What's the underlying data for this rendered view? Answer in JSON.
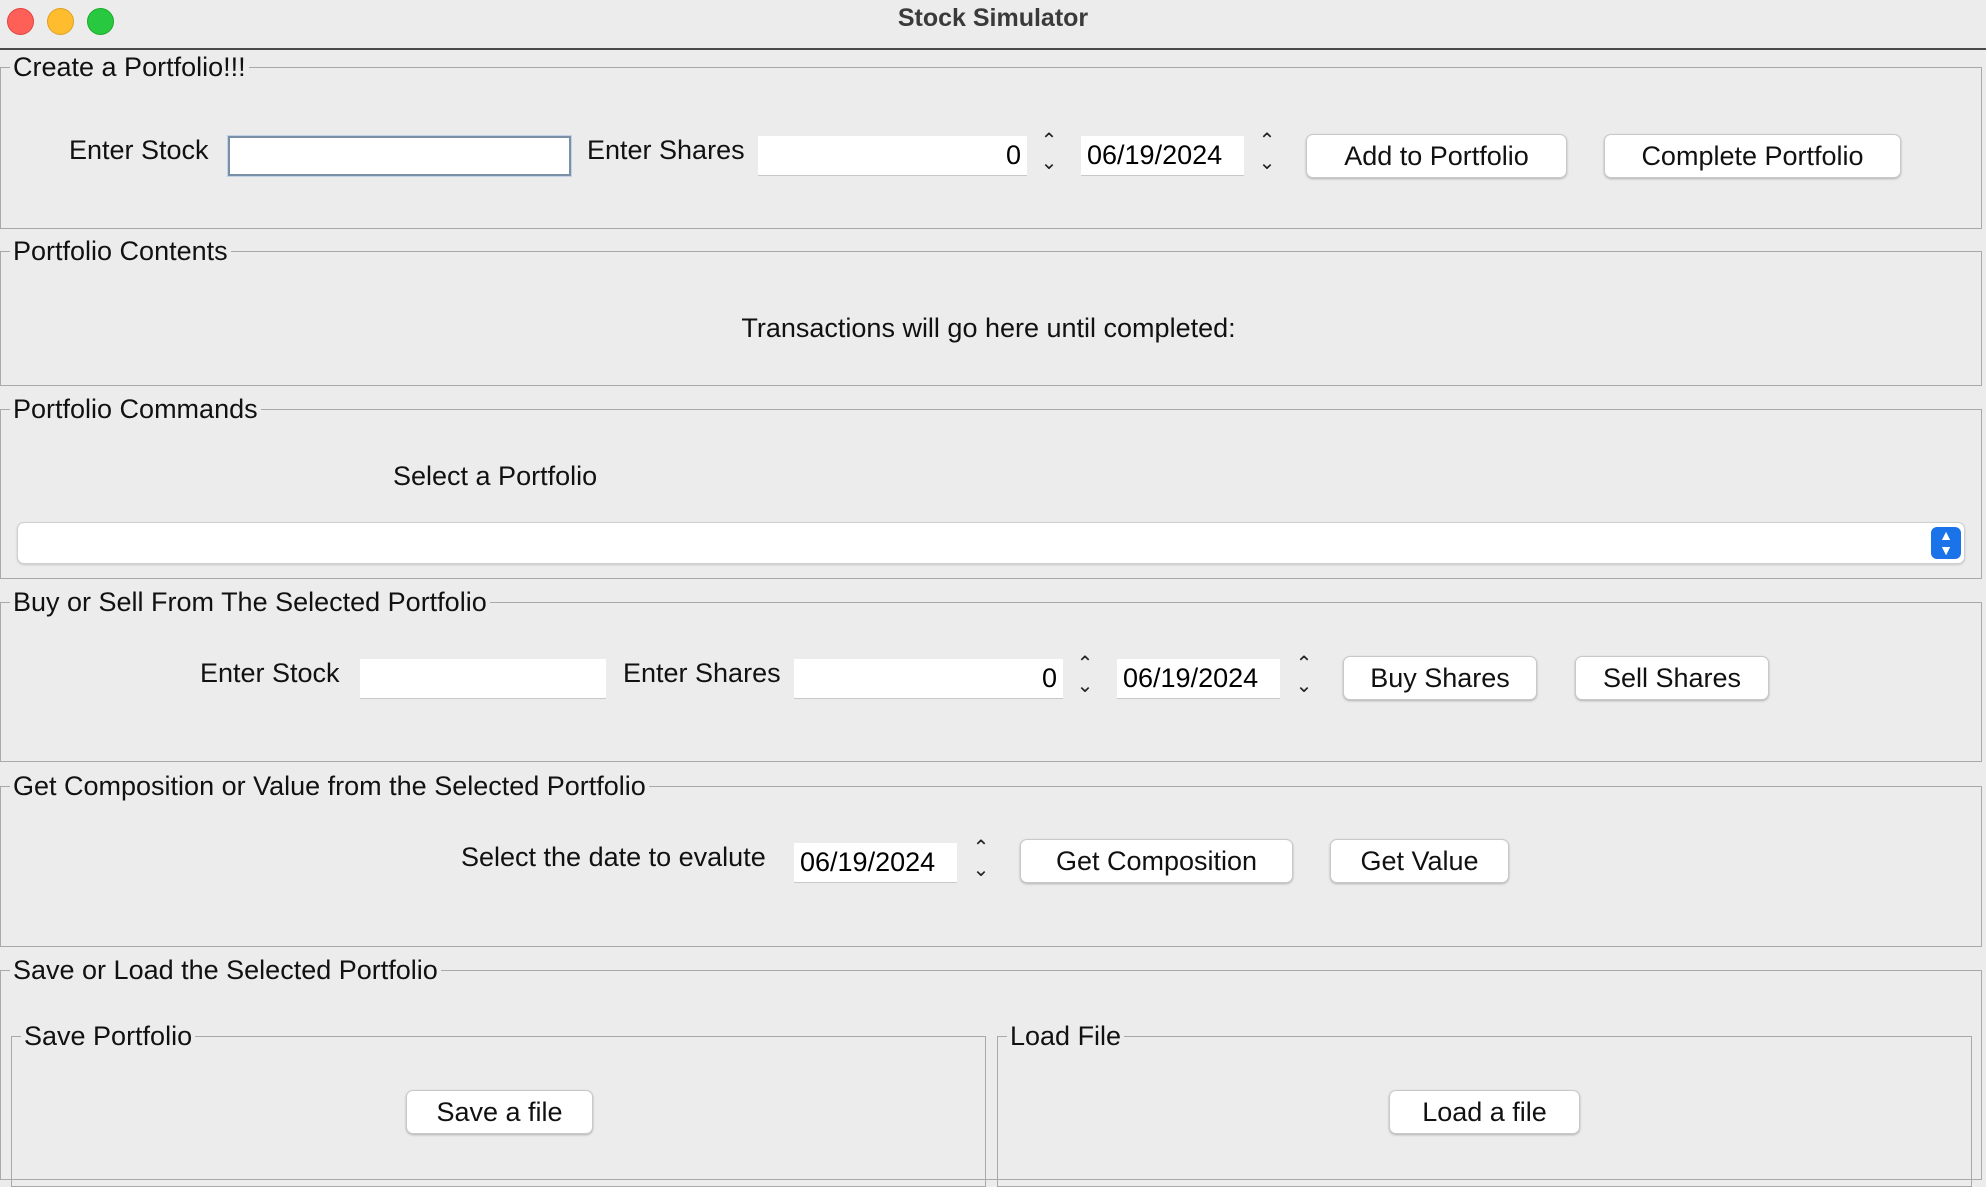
{
  "window": {
    "title": "Stock Simulator"
  },
  "create_portfolio": {
    "legend": "Create a Portfolio!!!",
    "stock_label": "Enter Stock",
    "stock_value": "",
    "shares_label": "Enter Shares",
    "shares_value": "0",
    "date_value": "06/19/2024",
    "add_button": "Add to Portfolio",
    "complete_button": "Complete Portfolio"
  },
  "portfolio_contents": {
    "legend": "Portfolio Contents",
    "message": "Transactions will go here until completed:"
  },
  "portfolio_commands": {
    "legend": "Portfolio Commands",
    "select_label": "Select a Portfolio",
    "selected_value": ""
  },
  "buy_sell": {
    "legend": "Buy or Sell From The Selected Portfolio",
    "stock_label": "Enter Stock",
    "stock_value": "",
    "shares_label": "Enter Shares",
    "shares_value": "0",
    "date_value": "06/19/2024",
    "buy_button": "Buy Shares",
    "sell_button": "Sell Shares"
  },
  "composition_value": {
    "legend": "Get Composition or Value from the Selected Portfolio",
    "date_label": "Select the date to evalute",
    "date_value": "06/19/2024",
    "composition_button": "Get Composition",
    "value_button": "Get Value"
  },
  "save_load": {
    "legend": "Save or Load the Selected Portfolio",
    "save_legend": "Save Portfolio",
    "save_button": "Save a file",
    "load_legend": "Load File",
    "load_button": "Load a file"
  },
  "colors": {
    "window_bg": "#ececec",
    "close": "#fe5f57",
    "minimize": "#febc2e",
    "maximize": "#28c840",
    "combo_accent": "#1a73e8"
  }
}
